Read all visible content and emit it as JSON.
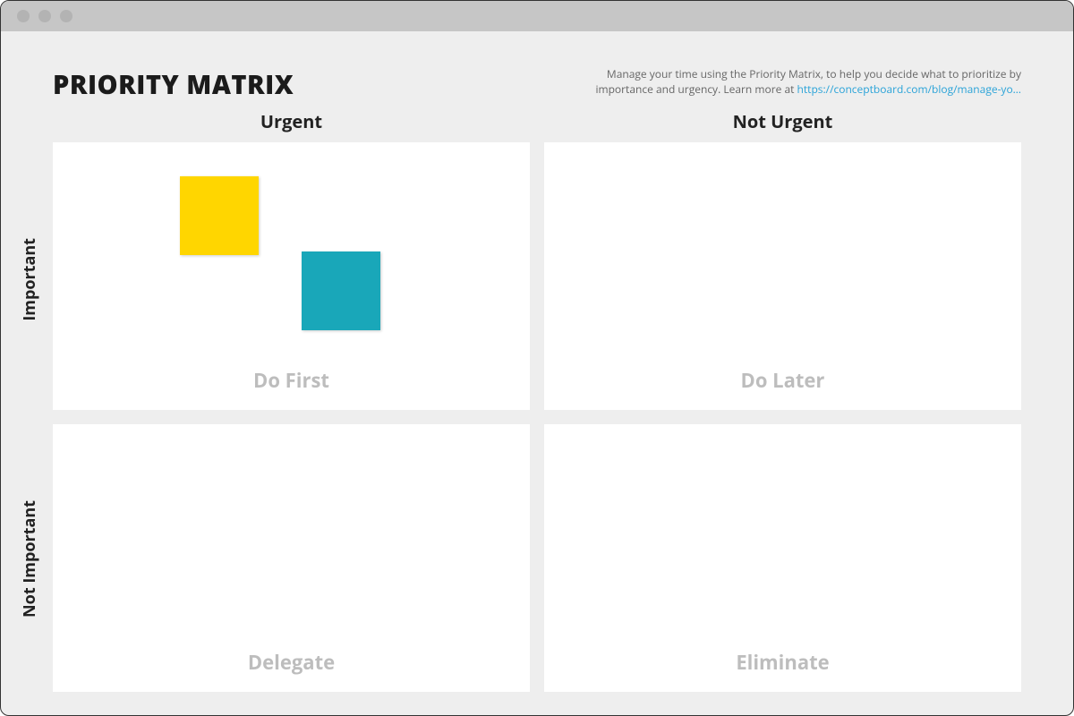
{
  "window": {
    "title": "PRIORITY MATRIX",
    "description_text": "Manage your time using the Priority Matrix, to help you decide what to prioritize by importance and urgency. Learn more at ",
    "description_link": "https://conceptboard.com/blog/manage-yo…"
  },
  "columns": {
    "left": "Urgent",
    "right": "Not Urgent"
  },
  "rows": {
    "top": "Important",
    "bottom": "Not Important"
  },
  "quadrants": {
    "q1": "Do First",
    "q2": "Do Later",
    "q3": "Delegate",
    "q4": "Eliminate"
  },
  "notes": {
    "yellow_color": "#ffd600",
    "teal_color": "#19a7b9"
  }
}
